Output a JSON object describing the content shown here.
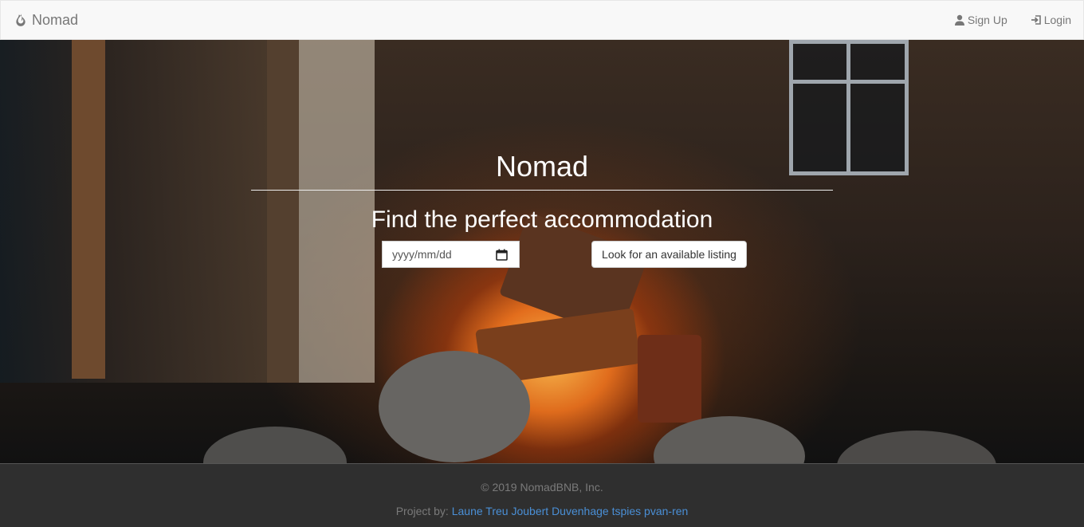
{
  "navbar": {
    "brand": {
      "icon": "fire-icon",
      "label": "Nomad"
    },
    "links": [
      {
        "icon": "user-icon",
        "label": "Sign Up"
      },
      {
        "icon": "login-icon",
        "label": "Login"
      }
    ]
  },
  "hero": {
    "title": "Nomad",
    "subtitle": "Find the perfect accommodation",
    "date_input": {
      "placeholder": "yyyy/mm/dd",
      "icon": "calendar-icon"
    },
    "search_button": "Look for an available listing"
  },
  "footer": {
    "copyright": "© 2019 NomadBNB, Inc.",
    "project_prefix": "Project by:",
    "authors": [
      "Laune",
      "Treu",
      "Joubert",
      "Duvenhage",
      "tspies",
      "pvan-ren"
    ]
  },
  "colors": {
    "navbar_bg": "#f8f8f8",
    "footer_bg": "#2f2f2f",
    "link": "#4a8fd6"
  }
}
